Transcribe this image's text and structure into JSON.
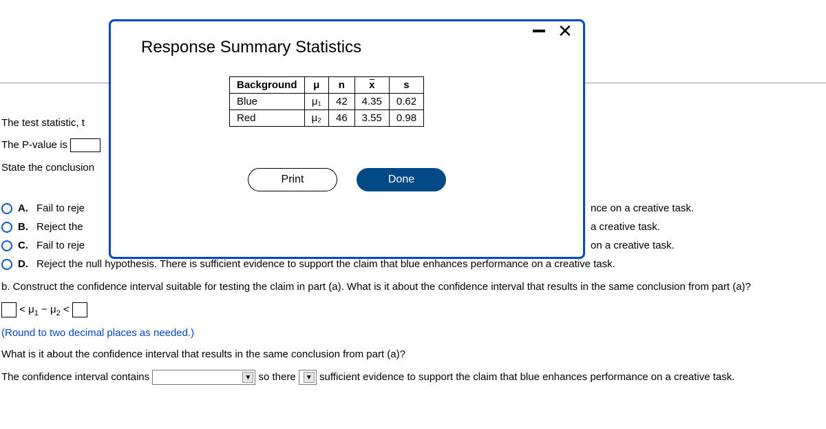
{
  "background": {
    "line_test_stat": "The test statistic, t",
    "line_pvalue_prefix": "The P-value is",
    "line_state": "State the conclusion",
    "options": {
      "A": {
        "label": "A.",
        "text_left": "Fail to reje",
        "text_right": "nce on a creative task."
      },
      "B": {
        "label": "B.",
        "text_left": "Reject the",
        "text_right": "a creative task."
      },
      "C": {
        "label": "C.",
        "text_left": "Fail to reje",
        "text_right": "on a creative task."
      },
      "D": {
        "label": "D.",
        "text_full": "Reject the null hypothesis. There is sufficient evidence to support the claim that blue enhances performance on a creative task."
      }
    },
    "part_b": "b. Construct the confidence interval suitable for testing the claim in part (a). What is it about the confidence interval that results in the same conclusion from part (a)?",
    "ci_mid": "< μ",
    "ci_sub1": "1",
    "ci_minus": " − μ",
    "ci_sub2": "2",
    "ci_lt2": " <",
    "round_note": "(Round to two decimal places as needed.)",
    "q_repeat": "What is it about the confidence interval that results in the same conclusion from part (a)?",
    "final_prefix": "The confidence interval contains",
    "final_mid": "so there",
    "final_suffix": "sufficient evidence to support the claim that blue enhances performance on a creative task."
  },
  "modal": {
    "title": "Response Summary Statistics",
    "buttons": {
      "print": "Print",
      "done": "Done"
    },
    "table": {
      "headers": {
        "bg": "Background",
        "mu": "μ",
        "n": "n",
        "xbar": "x",
        "s": "s"
      },
      "rows": [
        {
          "bg": "Blue",
          "mu": "μ₁",
          "n": "42",
          "xbar": "4.35",
          "s": "0.62"
        },
        {
          "bg": "Red",
          "mu": "μ₂",
          "n": "46",
          "xbar": "3.55",
          "s": "0.98"
        }
      ]
    }
  },
  "chart_data": {
    "type": "table",
    "title": "Response Summary Statistics",
    "columns": [
      "Background",
      "μ",
      "n",
      "x̄",
      "s"
    ],
    "rows": [
      [
        "Blue",
        "μ1",
        42,
        4.35,
        0.62
      ],
      [
        "Red",
        "μ2",
        46,
        3.55,
        0.98
      ]
    ]
  }
}
